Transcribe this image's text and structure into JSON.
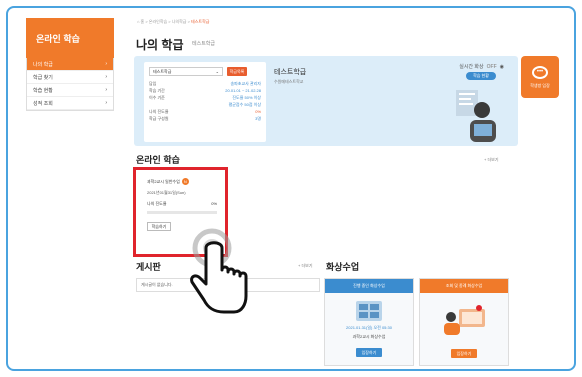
{
  "colors": {
    "brand": "#f07a2a",
    "accent_red": "#e0242c",
    "blue": "#3b8ccf",
    "panel": "#dcedf9"
  },
  "sidebar": {
    "title": "온라인 학습",
    "items": [
      {
        "label": "나의 학급",
        "active": true
      },
      {
        "label": "학급 찾기"
      },
      {
        "label": "학습 현황"
      },
      {
        "label": "성적 조회"
      }
    ]
  },
  "breadcrumb": {
    "home": "⌂ 홈",
    "path1": "온라인학습",
    "path2": "나의학급",
    "current": "테스트학급"
  },
  "header": {
    "title": "나의 학급",
    "subtitle": "테스트학급"
  },
  "info": {
    "select_value": "테스트학급",
    "select_button": "학급목록",
    "rows": [
      {
        "k": "담임",
        "v": "송파초교사 관리자"
      },
      {
        "k": "학습 기간",
        "v": "20.01.01 ~ 21.02.28"
      },
      {
        "k": "이수 기준",
        "v": "진도율 50% 이상"
      },
      {
        "k": "",
        "v": "평균점수 50점 이상"
      },
      {
        "k": "나의 진도율",
        "v": "0%"
      },
      {
        "k": "학급 구성원",
        "v": "3명"
      }
    ],
    "class_name": "테스트학급",
    "school": "수원메테스트학교",
    "realtime_label": "실시간 화상",
    "realtime_state": "OFF",
    "realtime_button": "학습 현황"
  },
  "fab": {
    "label": "학생방 입장",
    "icon": "chat-icon"
  },
  "online": {
    "title": "온라인 학습",
    "more": "더보기",
    "course": {
      "title": "과학2교시 일반수업",
      "badge": "N",
      "date": "2021년01월31일(Sun)",
      "progress_label": "나의 진도율",
      "progress_value": "0%",
      "progress": 0,
      "button": "학습하기"
    }
  },
  "board": {
    "title": "게시판",
    "more": "더보기",
    "empty": "게시글이 없습니다."
  },
  "video": {
    "title": "화상수업",
    "ongoing": {
      "header": "진행 중인 화상수업",
      "time": "2021.01.31(일) 오전 05:30",
      "name": "과학2교시 화상수업",
      "button": "입장하기"
    },
    "scheduled": {
      "header": "조회 및 종례 화상수업",
      "button": "입장하기"
    }
  }
}
